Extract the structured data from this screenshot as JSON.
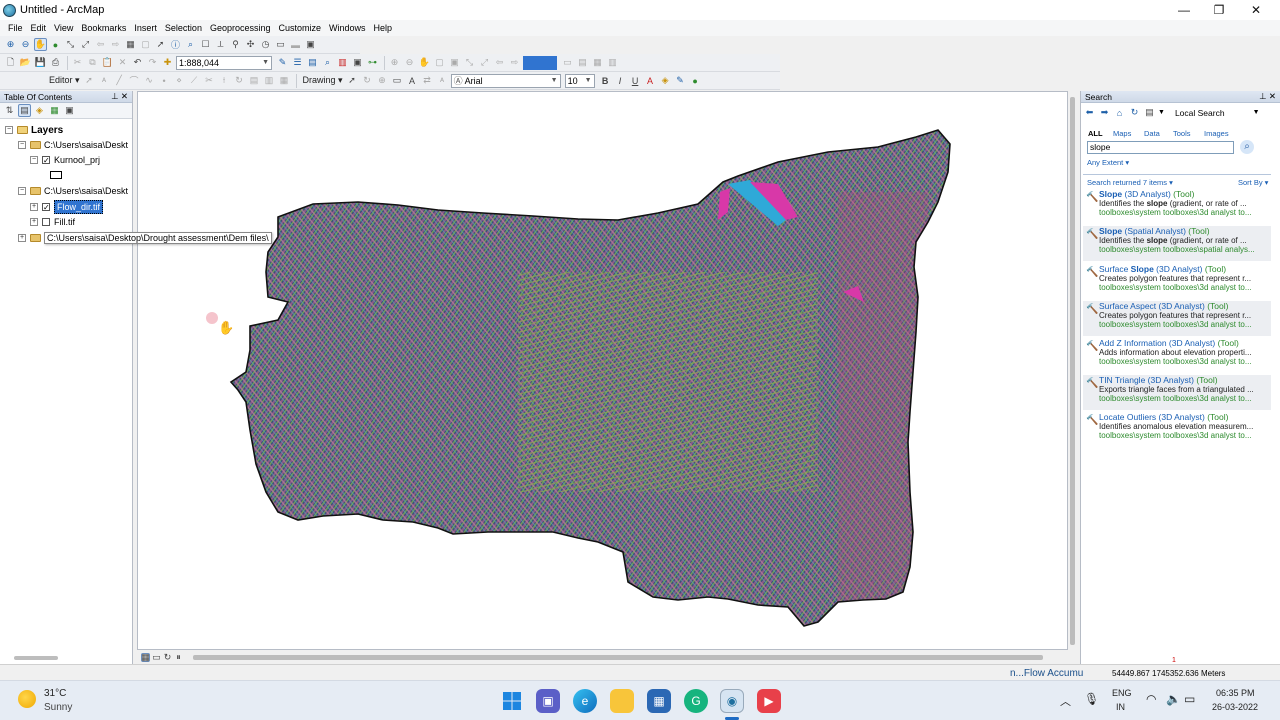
{
  "window": {
    "title": "Untitled - ArcMap",
    "min_icon": "minimize-icon",
    "max_icon": "restore-icon",
    "close_icon": "close-icon"
  },
  "menu": [
    "File",
    "Edit",
    "View",
    "Bookmarks",
    "Insert",
    "Selection",
    "Geoprocessing",
    "Customize",
    "Windows",
    "Help"
  ],
  "toolbar": {
    "scale_value": "1:888,044",
    "editor_label": "Editor ▾",
    "drawing_label": "Drawing ▾",
    "font_name": "Arial",
    "font_size": "10",
    "bold": "B",
    "italic": "I",
    "underline": "U"
  },
  "toc": {
    "title": "Table Of Contents",
    "root": "Layers",
    "items": [
      {
        "label": "C:\\Users\\saisa\\Deskt"
      },
      {
        "label": "Kurnool_prj"
      },
      {
        "label": "C:\\Users\\saisa\\Deskt"
      },
      {
        "label": "Flow_dir.tif"
      },
      {
        "label": "Fill.tif"
      },
      {
        "label": "C:\\Users\\saisa\\Desktop\\Drought assessment\\Dem files\\"
      }
    ]
  },
  "search": {
    "title": "Search",
    "scope": "Local Search",
    "filters": [
      "ALL",
      "Maps",
      "Data",
      "Tools",
      "Images"
    ],
    "query": "slope",
    "any_extent": "Any Extent ▾",
    "returned": "Search returned 7 items ▾",
    "sort": "Sort By ▾",
    "results": [
      {
        "name_pre": "",
        "name_bold": "Slope",
        "name_post": " (3D Analyst)",
        "kind": " (Tool)",
        "desc_pre": "Identifies the ",
        "desc_bold": "slope",
        "desc_post": " (gradient, or rate of ...",
        "path": "toolboxes\\system toolboxes\\3d analyst to..."
      },
      {
        "name_pre": "",
        "name_bold": "Slope",
        "name_post": " (Spatial Analyst)",
        "kind": " (Tool)",
        "desc_pre": "Identifies the ",
        "desc_bold": "slope",
        "desc_post": " (gradient, or rate of ...",
        "path": "toolboxes\\system toolboxes\\spatial analys..."
      },
      {
        "name_pre": "Surface ",
        "name_bold": "Slope",
        "name_post": " (3D Analyst)",
        "kind": " (Tool)",
        "desc_pre": "Creates polygon features that represent r...",
        "desc_bold": "",
        "desc_post": "",
        "path": "toolboxes\\system toolboxes\\3d analyst to..."
      },
      {
        "name_pre": "Surface Aspect (3D Analyst)",
        "name_bold": "",
        "name_post": "",
        "kind": " (Tool)",
        "desc_pre": "Creates polygon features that represent r...",
        "desc_bold": "",
        "desc_post": "",
        "path": "toolboxes\\system toolboxes\\3d analyst to..."
      },
      {
        "name_pre": "Add Z Information (3D Analyst)",
        "name_bold": "",
        "name_post": "",
        "kind": " (Tool)",
        "desc_pre": "Adds information about elevation properti...",
        "desc_bold": "",
        "desc_post": "",
        "path": "toolboxes\\system toolboxes\\3d analyst to..."
      },
      {
        "name_pre": "TIN Triangle (3D Analyst)",
        "name_bold": "",
        "name_post": "",
        "kind": " (Tool)",
        "desc_pre": "Exports triangle faces from a triangulated ...",
        "desc_bold": "",
        "desc_post": "",
        "path": "toolboxes\\system toolboxes\\3d analyst to..."
      },
      {
        "name_pre": "Locate Outliers (3D Analyst)",
        "name_bold": "",
        "name_post": "",
        "kind": " (Tool)",
        "desc_pre": "Identifies anomalous elevation measurem...",
        "desc_bold": "",
        "desc_post": "",
        "path": "toolboxes\\system toolboxes\\3d analyst to..."
      }
    ]
  },
  "status": {
    "progress_text": "n...Flow Accumu",
    "coordinates": "54449.867  1745352.636 Meters",
    "marker": "1"
  },
  "taskbar": {
    "weather_temp": "31°C",
    "weather_text": "Sunny",
    "lang1": "ENG",
    "lang2": "IN",
    "time": "06:35 PM",
    "date": "26-03-2022"
  },
  "colors": {
    "accent": "#1a5fb4",
    "selection": "#3074d0",
    "tool_path": "#2e8b2e"
  }
}
